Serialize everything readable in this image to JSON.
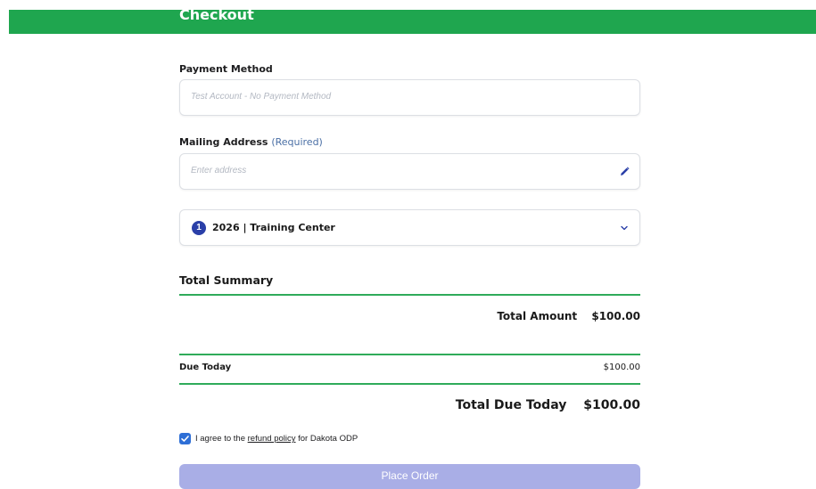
{
  "header": {
    "title": "Checkout",
    "bar_color": "#1fa64f"
  },
  "payment": {
    "label": "Payment Method",
    "placeholder": "Test Account - No Payment Method"
  },
  "address": {
    "label": "Mailing Address",
    "required_label": "(Required)",
    "placeholder": "Enter address",
    "edit_icon": "pencil-icon"
  },
  "order_item": {
    "badge": "1",
    "title": "2026 | Training Center",
    "expand_icon": "chevron-down-icon"
  },
  "summary": {
    "title": "Total Summary",
    "total_amount_label": "Total Amount",
    "total_amount_value": "$100.00",
    "due_today_label": "Due Today",
    "due_today_value": "$100.00",
    "total_due_label": "Total Due Today",
    "total_due_value": "$100.00"
  },
  "agreement": {
    "checked": true,
    "prefix": "I agree to the ",
    "link": "refund policy",
    "suffix": " for Dakota ODP"
  },
  "place_order": {
    "label": "Place Order",
    "color": "#a9aee6"
  },
  "colors": {
    "accent_green": "#1fa64f",
    "badge_blue": "#2a3fa8",
    "checkbox_blue": "#2e6fd6"
  }
}
